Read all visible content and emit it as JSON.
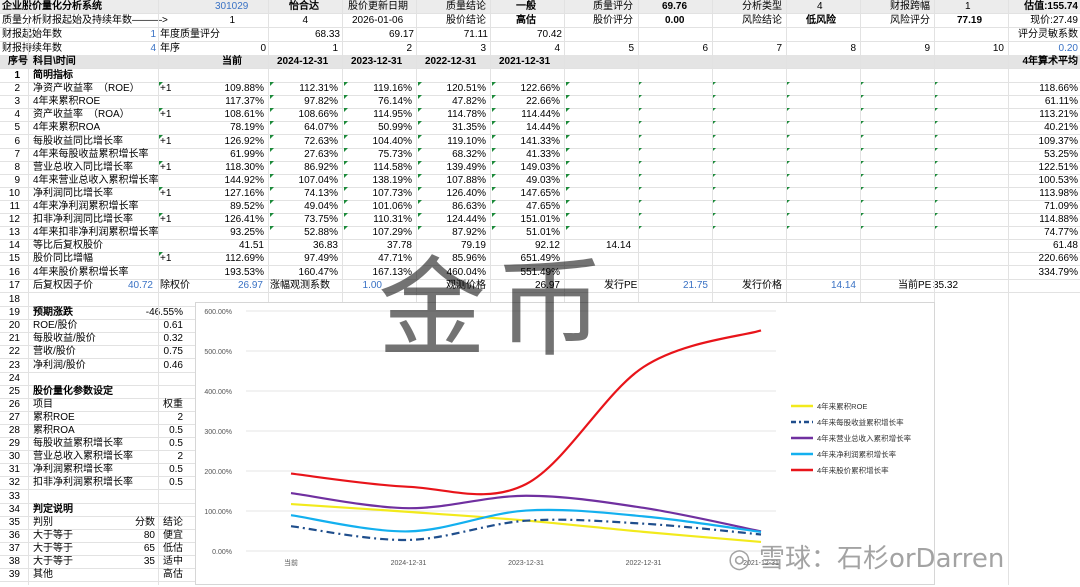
{
  "header": {
    "row1": {
      "title": "企业股价量化分析系统",
      "code": "301029",
      "name": "怡合达",
      "update_label": "股价更新日期",
      "quality_label": "质量结论",
      "quality_value": "一般",
      "score_label": "质量评分",
      "score_value": "69.76",
      "type_label": "分析类型",
      "type_value": "4",
      "span_label": "财报跨幅",
      "span_value": "1",
      "valuation": "估值:155.74"
    },
    "row2": {
      "label": "质量分析财报起始及持续年数———>",
      "start": "1",
      "years": "4",
      "date": "2026-01-06",
      "price_label": "股价结论",
      "price_value": "高估",
      "price_score_label": "股价评分",
      "price_score_value": "0.00",
      "risk_label": "风险结论",
      "risk_value": "低风险",
      "risk_score_label": "风险评分",
      "risk_score_value": "77.19",
      "current_price": "现价:27.49"
    },
    "row3": {
      "label": "财报起始年数",
      "value": "1",
      "q_label": "年度质量评分",
      "q1": "68.33",
      "q2": "69.17",
      "q3": "71.11",
      "q4": "70.42",
      "right": "评分灵敏系数"
    },
    "row4": {
      "label": "财报持续年数",
      "value": "4",
      "seq_label": "年序",
      "seqs": [
        "0",
        "1",
        "2",
        "3",
        "4",
        "5",
        "6",
        "7",
        "8",
        "9",
        "10"
      ],
      "sens": "0.20"
    }
  },
  "columns": {
    "seq": "序号",
    "item": "科目\\时间",
    "cur": "当前",
    "y1": "2024-12-31",
    "y2": "2023-12-31",
    "y3": "2022-12-31",
    "y4": "2021-12-31",
    "avg": "4年算术平均"
  },
  "rows": [
    {
      "n": "1",
      "name": "简明指标",
      "bold": true
    },
    {
      "n": "2",
      "name": "净资产收益率　（ROE）",
      "plus": "+1",
      "cur": "109.88%",
      "y1": "112.31%",
      "y2": "119.16%",
      "y3": "120.51%",
      "y4": "122.66%",
      "avg": "118.66%"
    },
    {
      "n": "3",
      "name": "4年来累积ROE",
      "cur": "117.37%",
      "y1": "97.82%",
      "y2": "76.14%",
      "y3": "47.82%",
      "y4": "22.66%",
      "avg": "61.11%"
    },
    {
      "n": "4",
      "name": "资产收益率　（ROA）",
      "plus": "+1",
      "cur": "108.61%",
      "y1": "108.66%",
      "y2": "114.95%",
      "y3": "114.78%",
      "y4": "114.44%",
      "avg": "113.21%"
    },
    {
      "n": "5",
      "name": "4年来累积ROA",
      "cur": "78.19%",
      "y1": "64.07%",
      "y2": "50.99%",
      "y3": "31.35%",
      "y4": "14.44%",
      "avg": "40.21%"
    },
    {
      "n": "6",
      "name": "每股收益同比增长率",
      "plus": "+1",
      "cur": "126.92%",
      "y1": "72.63%",
      "y2": "104.40%",
      "y3": "119.10%",
      "y4": "141.33%",
      "avg": "109.37%"
    },
    {
      "n": "7",
      "name": "4年来每股收益累积增长率",
      "cur": "61.99%",
      "y1": "27.63%",
      "y2": "75.73%",
      "y3": "68.32%",
      "y4": "41.33%",
      "avg": "53.25%"
    },
    {
      "n": "8",
      "name": "营业总收入同比增长率",
      "plus": "+1",
      "cur": "118.30%",
      "y1": "86.92%",
      "y2": "114.58%",
      "y3": "139.49%",
      "y4": "149.03%",
      "avg": "122.51%"
    },
    {
      "n": "9",
      "name": "4年来营业总收入累积增长率",
      "cur": "144.92%",
      "y1": "107.04%",
      "y2": "138.19%",
      "y3": "107.88%",
      "y4": "49.03%",
      "avg": "100.53%"
    },
    {
      "n": "10",
      "name": "净利润同比增长率",
      "plus": "+1",
      "cur": "127.16%",
      "y1": "74.13%",
      "y2": "107.73%",
      "y3": "126.40%",
      "y4": "147.65%",
      "avg": "113.98%"
    },
    {
      "n": "11",
      "name": "4年来净利润累积增长率",
      "cur": "89.52%",
      "y1": "49.04%",
      "y2": "101.06%",
      "y3": "86.63%",
      "y4": "47.65%",
      "avg": "71.09%"
    },
    {
      "n": "12",
      "name": "扣非净利润同比增长率",
      "plus": "+1",
      "cur": "126.41%",
      "y1": "73.75%",
      "y2": "110.31%",
      "y3": "124.44%",
      "y4": "151.01%",
      "avg": "114.88%"
    },
    {
      "n": "13",
      "name": "4年来扣非净利润累积增长率",
      "cur": "93.25%",
      "y1": "52.88%",
      "y2": "107.29%",
      "y3": "87.92%",
      "y4": "51.01%",
      "avg": "74.77%"
    },
    {
      "n": "14",
      "name": "等比后复权股价",
      "cur": "41.51",
      "y1": "36.83",
      "y2": "37.78",
      "y3": "79.19",
      "y4": "92.12",
      "extra": "14.14",
      "avg": "61.48"
    },
    {
      "n": "15",
      "name": "股价同比增幅",
      "plus": "+1",
      "cur": "112.69%",
      "y1": "97.49%",
      "y2": "47.71%",
      "y3": "85.96%",
      "y4": "651.49%",
      "avg": "220.66%"
    },
    {
      "n": "16",
      "name": "4年来股价累积增长率",
      "cur": "193.53%",
      "y1": "160.47%",
      "y2": "167.13%",
      "y3": "460.04%",
      "y4": "551.49%",
      "avg": "334.79%"
    }
  ],
  "row17": {
    "n": "17",
    "a": "后复权因子价",
    "b": "40.72",
    "c": "除权价",
    "d": "26.97",
    "e": "涨幅观测系数",
    "f": "1.00",
    "g": "观测价格",
    "h": "26.97",
    "i": "发行PE",
    "j": "21.75",
    "k": "发行价格",
    "l": "14.14",
    "m": "当前PE",
    "o": "35.32"
  },
  "left_panel": [
    {
      "n": "18",
      "a": "",
      "b": ""
    },
    {
      "n": "19",
      "a": "预期涨跌",
      "b": "-46.55%",
      "bold": true
    },
    {
      "n": "20",
      "a": "ROE/股价",
      "b": "0.61"
    },
    {
      "n": "21",
      "a": "每股收益/股价",
      "b": "0.32"
    },
    {
      "n": "22",
      "a": "营收/股价",
      "b": "0.75"
    },
    {
      "n": "23",
      "a": "净利润/股价",
      "b": "0.46"
    },
    {
      "n": "24",
      "a": "",
      "b": ""
    },
    {
      "n": "25",
      "a": "股价量化参数设定",
      "b": "",
      "bold": true
    },
    {
      "n": "26",
      "a": "项目",
      "b": "权重"
    },
    {
      "n": "27",
      "a": "累积ROE",
      "b": "2"
    },
    {
      "n": "28",
      "a": "累积ROA",
      "b": "0.5"
    },
    {
      "n": "29",
      "a": "每股收益累积增长率",
      "b": "0.5"
    },
    {
      "n": "30",
      "a": "营业总收入累积增长率",
      "b": "2"
    },
    {
      "n": "31",
      "a": "净利润累积增长率",
      "b": "0.5"
    },
    {
      "n": "32",
      "a": "扣非净利润累积增长率",
      "b": "0.5"
    },
    {
      "n": "33",
      "a": "",
      "b": ""
    },
    {
      "n": "34",
      "a": "判定说明",
      "b": "",
      "bold": true
    },
    {
      "n": "35",
      "a": "判别",
      "m": "分数",
      "b": "结论"
    },
    {
      "n": "36",
      "a": "大于等于",
      "m": "80",
      "b": "便宜"
    },
    {
      "n": "37",
      "a": "大于等于",
      "m": "65",
      "b": "低估"
    },
    {
      "n": "38",
      "a": "大于等于",
      "m": "35",
      "b": "适中"
    },
    {
      "n": "39",
      "a": "其他",
      "m": "",
      "b": "高估"
    }
  ],
  "chart_data": {
    "type": "line",
    "title": "怡合达",
    "categories": [
      "当前",
      "2024-12-31",
      "2023-12-31",
      "2022-12-31",
      "2021-12-31"
    ],
    "ylim": [
      0,
      600
    ],
    "yticks": [
      "0.00%",
      "100.00%",
      "200.00%",
      "300.00%",
      "400.00%",
      "500.00%",
      "600.00%"
    ],
    "legend_position": "right",
    "series": [
      {
        "name": "4年来累积ROE",
        "values": [
          117.37,
          97.82,
          76.14,
          47.82,
          22.66
        ],
        "color": "#f2ea1c",
        "dash": "none"
      },
      {
        "name": "4年来每股收益累积增长率",
        "values": [
          61.99,
          27.63,
          75.73,
          68.32,
          41.33
        ],
        "color": "#1f4e8c",
        "dash": "8,4,2,4"
      },
      {
        "name": "4年来营业总收入累积增长率",
        "values": [
          144.92,
          107.04,
          138.19,
          107.88,
          49.03
        ],
        "color": "#7030a0",
        "dash": "none"
      },
      {
        "name": "4年来净利润累积增长率",
        "values": [
          89.52,
          49.04,
          101.06,
          86.63,
          47.65
        ],
        "color": "#13b0ef",
        "dash": "none"
      },
      {
        "name": "4年来股价累积增长率",
        "values": [
          193.53,
          160.47,
          167.13,
          460.04,
          551.49
        ],
        "color": "#e8141a",
        "dash": "none"
      }
    ]
  },
  "watermark": {
    "big": "金币",
    "small": "雪球：石杉orDarren"
  }
}
